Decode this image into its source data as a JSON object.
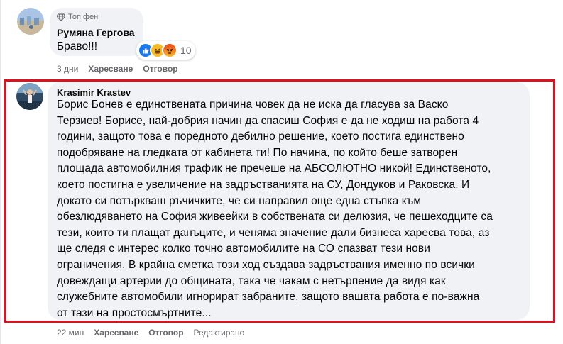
{
  "comment1": {
    "badge": "Топ фен",
    "author": "Румяна Гергова",
    "text": "Браво!!!",
    "reaction_count": "10",
    "reactions": [
      "like-reaction-icon",
      "haha-reaction-icon",
      "angry-reaction-icon"
    ],
    "time": "3 дни",
    "like_label": "Харесване",
    "reply_label": "Отговор"
  },
  "comment2": {
    "author": "Krasimir Krastev",
    "lines": [
      "Борис Бонев е единствената причина човек да не иска да гласува за Васко",
      "Терзиев! Борисе, най-добрия начин да спасиш София е да не ходиш на работа 4",
      "години, защото това е поредното дебилно решение, което постига единствено",
      "подобряване на гледката от кабинета ти! По начина, по който беше затворен",
      "площада автомобилния трафик не пречеше на АБСОЛЮТНО никой! Единственото,",
      "което постигна е увеличение на задръстванията на СУ, Дондуков и Раковска. И",
      "докато си потърквaш ръчичките, че си направил още една стъпка към",
      "обезлюдяването на София живеейки в собствената си делюзия, че пешеходците са",
      "тези, които ти плащат данъците, и ченяма значение дали бизнеса харесва това, аз",
      "ще следя с интерес колко точно автомобилите на СО спазват тези нови",
      "ограничения. В крайна сметка този ход създава задръствания именно по всички",
      "довеждащи артерии до общината, така че чакам с нетърпение да видя как",
      "служебните автомобили игнорират забраните, защото вашата работа е по-важна",
      "от тази на простосмъртните..."
    ],
    "time": "22 мин",
    "like_label": "Харесване",
    "reply_label": "Отговор",
    "edited_label": "Редактирано"
  },
  "colors": {
    "highlight": "#e0101f",
    "bubble": "#f0f2f5",
    "meta": "#65676b",
    "like_blue": "#1877f2",
    "haha_yellow": "#f7b928",
    "angry_red": "#e9710f"
  }
}
